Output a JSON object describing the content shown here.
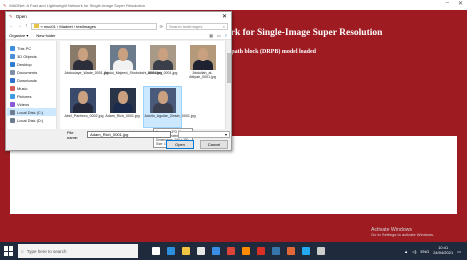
{
  "app": {
    "title": "MADNet: A Fast and Lightweight Network for Single-Image Super Resolution",
    "heading": "ork for Single-Image Super Resolution",
    "status": "d-path block (DRPB) model loaded",
    "minimize": "–",
    "close": "✕"
  },
  "dialog": {
    "title": "Open",
    "close": "✕",
    "path": [
      "This PC",
      "Local Disk (C:)",
      "Users",
      "muc01",
      "Desktop",
      "Madnet",
      "testImages"
    ],
    "path_display": "« muc01 › Madnet › testImages",
    "search_placeholder": "Search testImages",
    "organize": "Organize ▾",
    "new_folder": "New folder",
    "nav_items": [
      {
        "label": "This PC",
        "color": "#3d8ee0",
        "selected": false
      },
      {
        "label": "3D Objects",
        "color": "#4a90d9",
        "selected": false
      },
      {
        "label": "Desktop",
        "color": "#2d7dd2",
        "selected": false
      },
      {
        "label": "Documents",
        "color": "#7f8fa6",
        "selected": false
      },
      {
        "label": "Downloads",
        "color": "#2f6fd0",
        "selected": false
      },
      {
        "label": "Music",
        "color": "#d65a5a",
        "selected": false
      },
      {
        "label": "Pictures",
        "color": "#3c9be0",
        "selected": false
      },
      {
        "label": "Videos",
        "color": "#8a5ad6",
        "selected": false
      },
      {
        "label": "Local Disk (C:)",
        "color": "#6b7c8f",
        "selected": true
      },
      {
        "label": "Local Disk (D:)",
        "color": "#6b7c8f",
        "selected": false
      }
    ],
    "files": [
      {
        "name": "Abdoulaye_Wade_0001.jpg",
        "label": "Abdoulaye_Wade_0001.jpg",
        "bg": "#8a7a6a",
        "suit": "#2c2f3a",
        "selected": false
      },
      {
        "name": "Abdul_Majeed_Shobokshi_0001.jpg",
        "label": "Abdul_Majeed_Shobokshi_0001.jpg",
        "bg": "#6c7b8c",
        "suit": "#f2f2f2",
        "selected": false
      },
      {
        "name": "Abdullah_0001.jpg",
        "label": "Abdullah_0001.jpg",
        "bg": "#a89a86",
        "suit": "#3b3f4a",
        "selected": false
      },
      {
        "name": "Abdullah_al-Attiyah_0001.jpg",
        "label": "Abdullah_al-Attiyah_0001.jpg",
        "bg": "#b49a7a",
        "suit": "#1f2230",
        "selected": false
      },
      {
        "name": "Abel_Pacheco_0002.jpg",
        "label": "Abel_Pacheco_0002.jpg",
        "bg": "#3a4a6a",
        "suit": "#23283a",
        "selected": false
      },
      {
        "name": "Adam_Rich_0001.jpg",
        "label": "Adam_Rich_0001.jpg",
        "bg": "#2a3448",
        "suit": "#1a2a4a",
        "selected": false
      },
      {
        "name": "Adolfo_Aguilar_Zinser_0001.jpg",
        "label": "Adolfo_Aguilar_Zinser_0001.jpg",
        "bg": "#4a5a7a",
        "suit": "#3a3f50",
        "selected": true
      }
    ],
    "tooltip": [
      "Item type: JPG File",
      "Rating: Unrated",
      "Dimensions: 250 x 250",
      "Size: 15.8 KB"
    ],
    "filename_label": "File name:",
    "filename_value": "Adam_Rich_0001.jpg",
    "filetype_value": "▾",
    "open_button": "Open",
    "cancel_button": "Cancel"
  },
  "watermark": {
    "line1": "Activate Windows",
    "line2": "Go to Settings to activate Windows."
  },
  "taskbar": {
    "search_placeholder": "Type here to search",
    "icons": [
      {
        "name": "task-view-icon",
        "color": "#ffffff"
      },
      {
        "name": "edge-icon",
        "color": "#2e8fde"
      },
      {
        "name": "explorer-icon",
        "color": "#f4c542"
      },
      {
        "name": "store-icon",
        "color": "#e7e7e7"
      },
      {
        "name": "mail-icon",
        "color": "#3a8ee6"
      },
      {
        "name": "chrome-icon",
        "color": "#db4437"
      },
      {
        "name": "firefox-icon",
        "color": "#ff8a00"
      },
      {
        "name": "pdf-icon",
        "color": "#d93025"
      },
      {
        "name": "python-icon",
        "color": "#3776ab"
      },
      {
        "name": "matlab-icon",
        "color": "#e16737"
      },
      {
        "name": "vscode-icon",
        "color": "#23a9f2"
      },
      {
        "name": "terminal-icon",
        "color": "#cccccc"
      }
    ],
    "language": "ENG",
    "time": "10:41",
    "date": "24/04/2021"
  }
}
